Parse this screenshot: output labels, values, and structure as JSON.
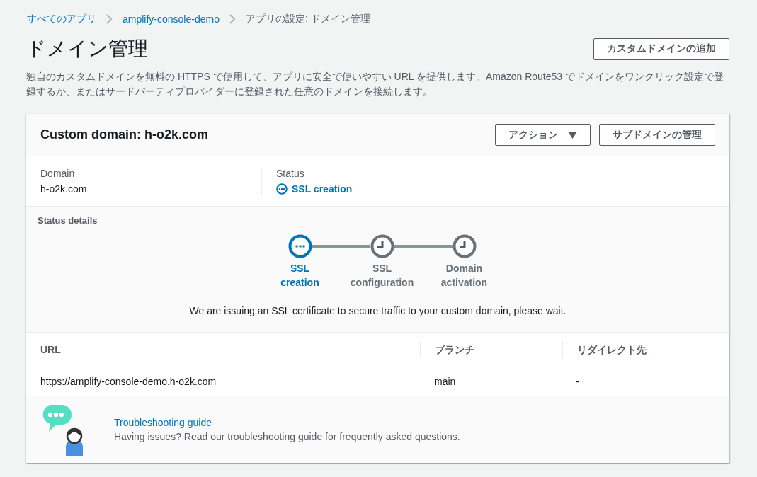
{
  "breadcrumbs": [
    {
      "label": "すべてのアプリ",
      "link": true
    },
    {
      "label": "amplify-console-demo",
      "link": true
    },
    {
      "label": "アプリの設定: ドメイン管理",
      "link": false
    }
  ],
  "page_title": "ドメイン管理",
  "add_button": "カスタムドメインの追加",
  "description": "独自のカスタムドメインを無料の HTTPS で使用して、アプリに安全で使いやすい URL を提供します。Amazon Route53 でドメインをワンクリック設定で登録するか、またはサードパーティプロバイダーに登録された任意のドメインを接続します。",
  "card": {
    "title": "Custom domain: h-o2k.com",
    "actions_button": "アクション",
    "subdomain_button": "サブドメインの管理",
    "domain_label": "Domain",
    "domain_value": "h-o2k.com",
    "status_label": "Status",
    "status_value": "SSL creation",
    "status_details_title": "Status details",
    "steps": [
      {
        "label": "SSL creation",
        "active": true
      },
      {
        "label": "SSL configuration",
        "active": false
      },
      {
        "label": "Domain activation",
        "active": false
      }
    ],
    "status_message": "We are issuing an SSL certificate to secure traffic to your custom domain, please wait.",
    "table": {
      "columns": [
        "URL",
        "ブランチ",
        "リダイレクト先"
      ],
      "rows": [
        [
          "https://amplify-console-demo.h-o2k.com",
          "main",
          "-"
        ]
      ]
    },
    "help": {
      "link": "Troubleshooting guide",
      "text": "Having issues? Read our troubleshooting guide for frequently asked questions."
    }
  }
}
